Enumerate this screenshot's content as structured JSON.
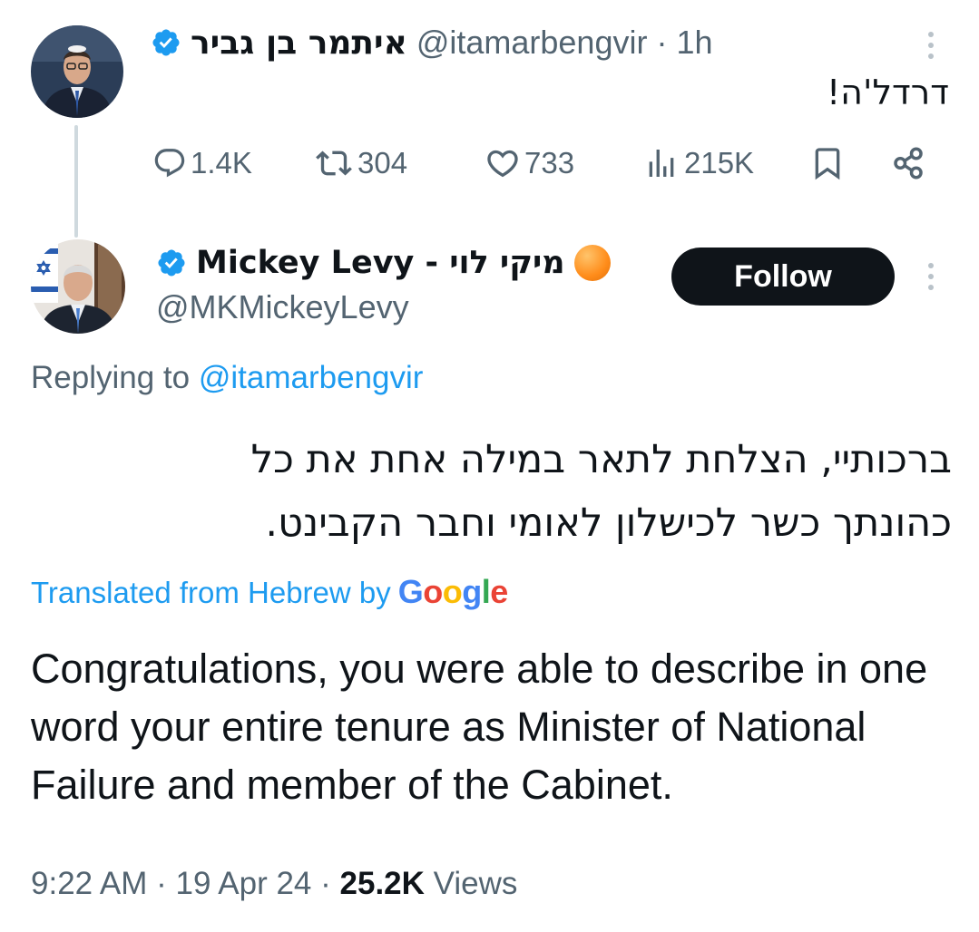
{
  "original_tweet": {
    "author_name": "איתמר בן גביר",
    "handle": "@itamarbengvir",
    "separator": "·",
    "time": "1h",
    "text": "דרדל'ה!",
    "stats": {
      "replies": "1.4K",
      "retweets": "304",
      "likes": "733",
      "views": "215K"
    }
  },
  "reply_tweet": {
    "author_name": "מיקי לוי - Mickey Levy",
    "handle": "@MKMickeyLevy",
    "follow_label": "Follow",
    "replying_prefix": "Replying to",
    "replying_to": "@itamarbengvir",
    "text_he_line1": "ברכותיי, הצלחת לתאר במילה אחת את כל",
    "text_he_line2": "כהונתך כשר לכישלון לאומי וחבר הקבינט.",
    "translated_label": "Translated from Hebrew by",
    "translated_brand": "Google",
    "translation": "Congratulations, you were able to describe in one word your entire tenure as Minister of National Failure and member of the Cabinet.",
    "time": "9:22 AM",
    "date": "19 Apr 24",
    "views_count": "25.2K",
    "views_label": "Views"
  },
  "colors": {
    "verified": "#1d9bf0",
    "accent": "#1d9bf0",
    "secondary_text": "#536471",
    "follow_bg": "#0f1419",
    "orange_badge": "#ff8c1a"
  },
  "icons": {
    "verified": "verified-badge-icon",
    "reply": "reply-icon",
    "retweet": "retweet-icon",
    "like": "heart-icon",
    "views": "bar-chart-icon",
    "bookmark": "bookmark-icon",
    "share": "share-icon",
    "more": "more-vertical-icon"
  }
}
